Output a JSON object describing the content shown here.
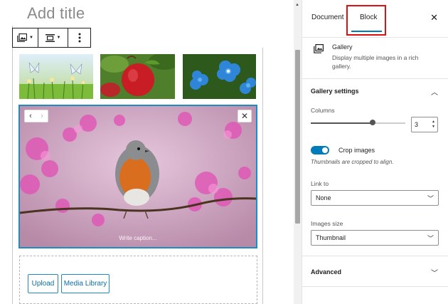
{
  "editor": {
    "title_placeholder": "Add title",
    "caption_placeholder": "Write caption...",
    "upload_label": "Upload",
    "media_library_label": "Media Library"
  },
  "sidebar": {
    "tabs": [
      {
        "label": "Document",
        "active": false
      },
      {
        "label": "Block",
        "active": true
      }
    ],
    "block": {
      "icon": "gallery-icon",
      "title": "Gallery",
      "description": "Display multiple images in a rich gallery."
    },
    "gallery_settings": {
      "title": "Gallery settings",
      "columns_label": "Columns",
      "columns_value": "3",
      "crop_label": "Crop images",
      "crop_enabled": true,
      "crop_help": "Thumbnails are cropped to align.",
      "link_to_label": "Link to",
      "link_to_value": "None",
      "image_size_label": "Images size",
      "image_size_value": "Thumbnail"
    },
    "advanced_label": "Advanced"
  },
  "colors": {
    "accent": "#007cba",
    "highlight_box": "#e01010",
    "selected_border": "#1e8cbe"
  }
}
